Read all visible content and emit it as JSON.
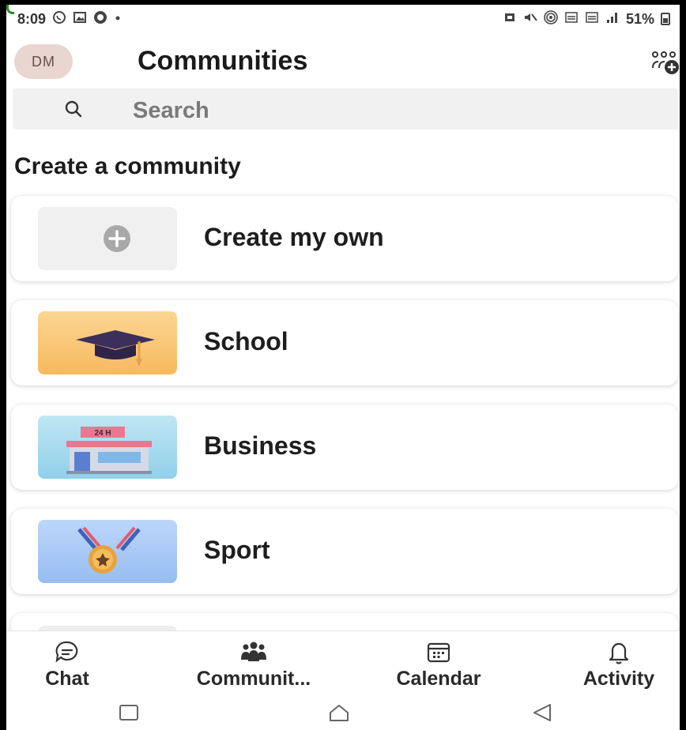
{
  "status_bar": {
    "time": "8:09",
    "battery": "51%",
    "left_icons": [
      "whatsapp-icon",
      "gallery-icon",
      "messenger-icon",
      "dot-icon"
    ],
    "right_icons": [
      "alarm-icon",
      "mute-icon",
      "hotspot-icon",
      "volte-icon",
      "volte-icon",
      "signal-icon",
      "battery-icon"
    ]
  },
  "header": {
    "avatar_initials": "DM",
    "title": "Communities",
    "action_icon": "new-community-icon"
  },
  "search": {
    "placeholder": "Search"
  },
  "section": {
    "heading": "Create a community"
  },
  "cards": [
    {
      "label": "Create my own",
      "icon": "plus-icon"
    },
    {
      "label": "School",
      "icon": "graduation-cap-icon"
    },
    {
      "label": "Business",
      "icon": "storefront-icon"
    },
    {
      "label": "Sport",
      "icon": "medal-icon"
    }
  ],
  "bottom_nav": [
    {
      "label": "Chat",
      "icon": "chat-icon"
    },
    {
      "label": "Communit...",
      "icon": "communities-icon"
    },
    {
      "label": "Calendar",
      "icon": "calendar-icon"
    },
    {
      "label": "Activity",
      "icon": "bell-icon"
    }
  ],
  "colors": {
    "avatar_bg": "#ead6d0",
    "search_bg": "#f1f1f1",
    "school_bg": "#f9c97a",
    "business_bg": "#a9dcef",
    "sport_bg": "#a9c8f5"
  }
}
